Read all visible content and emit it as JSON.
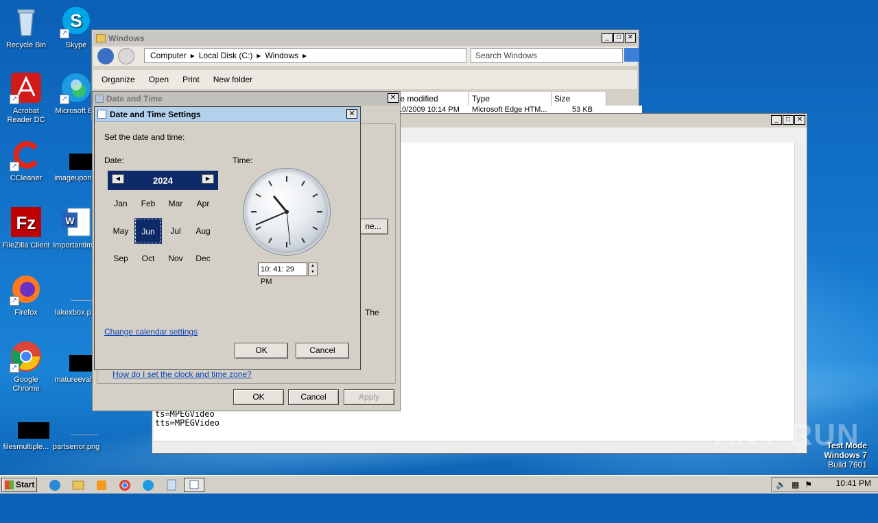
{
  "desktop": {
    "icons": [
      {
        "label": "Recycle Bin",
        "icon": "recycle-bin-icon"
      },
      {
        "label": "Skype",
        "icon": "skype-icon"
      },
      {
        "label": "Acrobat Reader DC",
        "icon": "acrobat-icon"
      },
      {
        "label": "Microsoft Ed",
        "icon": "edge-icon"
      },
      {
        "label": "CCleaner",
        "icon": "ccleaner-icon"
      },
      {
        "label": "imageupon...",
        "icon": "file-icon"
      },
      {
        "label": "FileZilla Client",
        "icon": "filezilla-icon"
      },
      {
        "label": "importantim...",
        "icon": "word-doc-icon"
      },
      {
        "label": "Firefox",
        "icon": "firefox-icon"
      },
      {
        "label": "lakexbox.p...",
        "icon": "file-icon"
      },
      {
        "label": "Google Chrome",
        "icon": "chrome-icon"
      },
      {
        "label": "matureeval...",
        "icon": "file-icon"
      },
      {
        "label": "filesmultiple...",
        "icon": "file-icon"
      },
      {
        "label": "partserror.png",
        "icon": "image-icon"
      }
    ]
  },
  "explorer": {
    "title": "Windows",
    "breadcrumb": [
      "Computer",
      "Local Disk (C:)",
      "Windows"
    ],
    "search_placeholder": "Search Windows",
    "toolbar": {
      "organize": "Organize",
      "open": "Open",
      "print": "Print",
      "new_folder": "New folder"
    },
    "columns": [
      "te modified",
      "Type",
      "Size"
    ],
    "row": {
      "date": "10/2009 10:14 PM",
      "type": "Microsoft Edge HTM...",
      "size": "53 KB"
    }
  },
  "notepad": {
    "lines": [
      "ts=MPEGVideo",
      "tts=MPEGVideo"
    ],
    "fragment_text": "The"
  },
  "date_time_props": {
    "title": "Date and Time",
    "help_link": "How do I set the clock and time zone?",
    "partial_button": "ne...",
    "ok": "OK",
    "cancel": "Cancel",
    "apply": "Apply"
  },
  "dts": {
    "title": "Date and Time Settings",
    "instruction": "Set the date and time:",
    "date_label": "Date:",
    "time_label": "Time:",
    "year": "2024",
    "months": [
      "Jan",
      "Feb",
      "Mar",
      "Apr",
      "May",
      "Jun",
      "Jul",
      "Aug",
      "Sep",
      "Oct",
      "Nov",
      "Dec"
    ],
    "selected_month": "Jun",
    "time_value": "10: 41: 29 PM",
    "change_calendar_link": "Change calendar settings",
    "ok": "OK",
    "cancel": "Cancel"
  },
  "taskbar": {
    "start": "Start",
    "clock": "10:41 PM"
  },
  "watermark": {
    "line1": "Test Mode",
    "line2": "Windows 7",
    "line3": "Build 7601",
    "brand": "ANY RUN"
  },
  "colors": {
    "desktop_bg": "#1272c9",
    "selection": "#0e2a68",
    "link": "#0a3fb4"
  }
}
